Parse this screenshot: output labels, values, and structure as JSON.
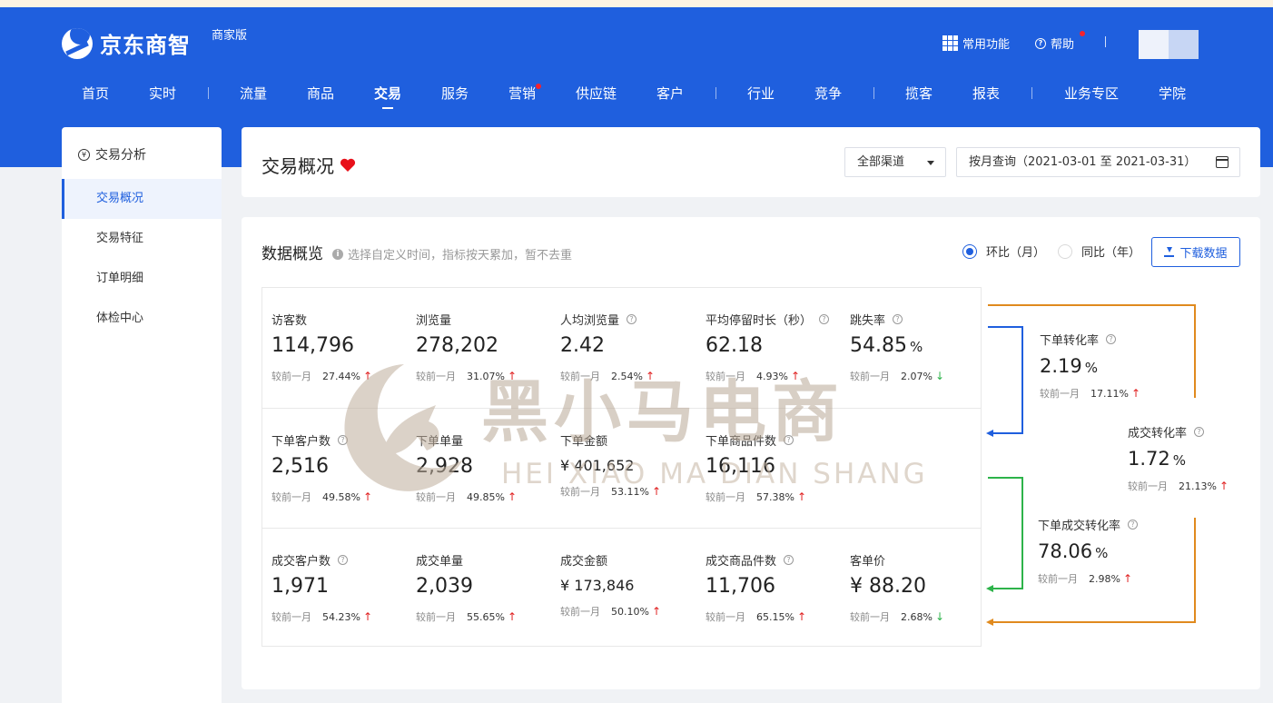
{
  "header": {
    "logo_text": "京东商智",
    "logo_sub": "商家版",
    "common_functions": "常用功能",
    "help": "帮助"
  },
  "nav": [
    {
      "label": "首页"
    },
    {
      "label": "实时"
    },
    {
      "label": "流量"
    },
    {
      "label": "商品"
    },
    {
      "label": "交易"
    },
    {
      "label": "服务"
    },
    {
      "label": "营销"
    },
    {
      "label": "供应链"
    },
    {
      "label": "客户"
    },
    {
      "label": "行业"
    },
    {
      "label": "竞争"
    },
    {
      "label": "揽客"
    },
    {
      "label": "报表"
    },
    {
      "label": "业务专区"
    },
    {
      "label": "学院"
    }
  ],
  "sidebar": {
    "title": "交易分析",
    "items": [
      {
        "label": "交易概况"
      },
      {
        "label": "交易特征"
      },
      {
        "label": "订单明细"
      },
      {
        "label": "体检中心"
      }
    ]
  },
  "overview": {
    "title": "交易概况",
    "channel": "全部渠道",
    "date_range": "按月查询（2021-03-01 至 2021-03-31）"
  },
  "data_section": {
    "title": "数据概览",
    "info": "选择自定义时间，指标按天累加，暂不去重",
    "radio_mom": "环比（月）",
    "radio_yoy": "同比（年）",
    "download": "下载数据",
    "compare_label": "较前一月"
  },
  "metrics": [
    [
      {
        "label": "访客数",
        "value": "114,796",
        "change": "27.44%",
        "dir": "↑"
      },
      {
        "label": "浏览量",
        "value": "278,202",
        "change": "31.07%",
        "dir": "↑"
      },
      {
        "label": "人均浏览量",
        "value": "2.42",
        "change": "2.54%",
        "dir": "↑"
      },
      {
        "label": "平均停留时长（秒）",
        "value": "62.18",
        "change": "4.93%",
        "dir": "↑"
      },
      {
        "label": "跳失率",
        "value": "54.85",
        "unit": "%",
        "change": "2.07%",
        "dir": "↓"
      }
    ],
    [
      {
        "label": "下单客户数",
        "value": "2,516",
        "change": "49.58%",
        "dir": "↑"
      },
      {
        "label": "下单单量",
        "value": "2,928",
        "change": "49.85%",
        "dir": "↑"
      },
      {
        "label": "下单金额",
        "value": "¥ 401,652",
        "change": "53.11%",
        "dir": "↑"
      },
      {
        "label": "下单商品件数",
        "value": "16,116",
        "change": "57.38%",
        "dir": "↑"
      }
    ],
    [
      {
        "label": "成交客户数",
        "value": "1,971",
        "change": "54.23%",
        "dir": "↑"
      },
      {
        "label": "成交单量",
        "value": "2,039",
        "change": "55.65%",
        "dir": "↑"
      },
      {
        "label": "成交金额",
        "value": "¥ 173,846",
        "change": "50.10%",
        "dir": "↑"
      },
      {
        "label": "成交商品件数",
        "value": "11,706",
        "change": "65.15%",
        "dir": "↑"
      },
      {
        "label": "客单价",
        "value": "¥ 88.20",
        "change": "2.68%",
        "dir": "↓"
      }
    ]
  ],
  "conversions": [
    {
      "label": "下单转化率",
      "value": "2.19",
      "unit": "%",
      "change": "17.11%",
      "dir": "↑"
    },
    {
      "label": "成交转化率",
      "value": "1.72",
      "unit": "%",
      "change": "21.13%",
      "dir": "↑"
    },
    {
      "label": "下单成交转化率",
      "value": "78.06",
      "unit": "%",
      "change": "2.98%",
      "dir": "↑"
    }
  ],
  "watermark": {
    "cn": "黑小马电商",
    "en": "HEI XIAO MA DIAN SHANG"
  },
  "colors": {
    "brand": "#1f5fde",
    "up": "#e02020",
    "down": "#2db34a",
    "flow_blue": "#1f5fde",
    "flow_green": "#2db34a",
    "flow_orange": "#e08a1e"
  }
}
